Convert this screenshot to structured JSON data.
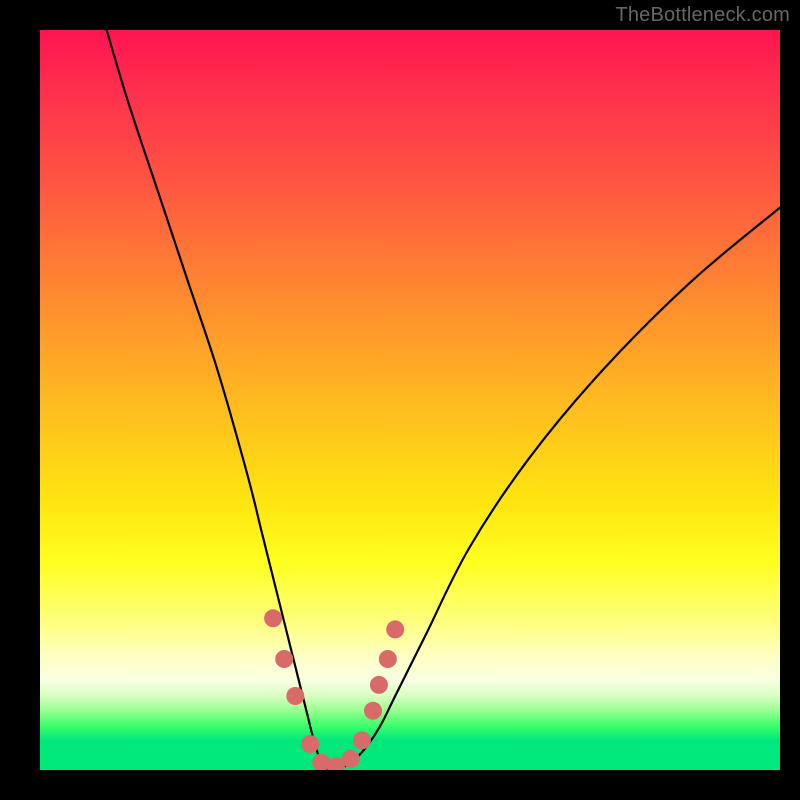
{
  "watermark": "TheBottleneck.com",
  "chart_data": {
    "type": "line",
    "title": "",
    "xlabel": "",
    "ylabel": "",
    "xlim": [
      0,
      100
    ],
    "ylim": [
      0,
      100
    ],
    "series": [
      {
        "name": "bottleneck-curve",
        "x": [
          9,
          12,
          16,
          20,
          24,
          28,
          30,
          32,
          34,
          36,
          37,
          38,
          39,
          40,
          42,
          44,
          46,
          48,
          52,
          58,
          66,
          76,
          88,
          100
        ],
        "values": [
          100,
          90,
          78,
          66,
          54,
          40,
          32,
          24,
          16,
          8,
          4,
          1,
          0,
          0,
          1,
          3,
          6,
          10,
          18,
          30,
          42,
          54,
          66,
          76
        ]
      }
    ],
    "markers": {
      "name": "highlight-dots",
      "color": "#d86a6a",
      "x": [
        31.5,
        33.0,
        34.5,
        36.5,
        38.0,
        40.0,
        42.0,
        43.5,
        45.0,
        45.8,
        47.0,
        48.0
      ],
      "values": [
        20.5,
        15.0,
        10.0,
        3.5,
        1.0,
        0.5,
        1.5,
        4.0,
        8.0,
        11.5,
        15.0,
        19.0
      ]
    },
    "gradient_stops": [
      {
        "pos": 0,
        "color": "#ff1450"
      },
      {
        "pos": 36,
        "color": "#ff8a30"
      },
      {
        "pos": 64,
        "color": "#ffe610"
      },
      {
        "pos": 88,
        "color": "#f6ffe0"
      },
      {
        "pos": 96,
        "color": "#00e87b"
      }
    ]
  }
}
